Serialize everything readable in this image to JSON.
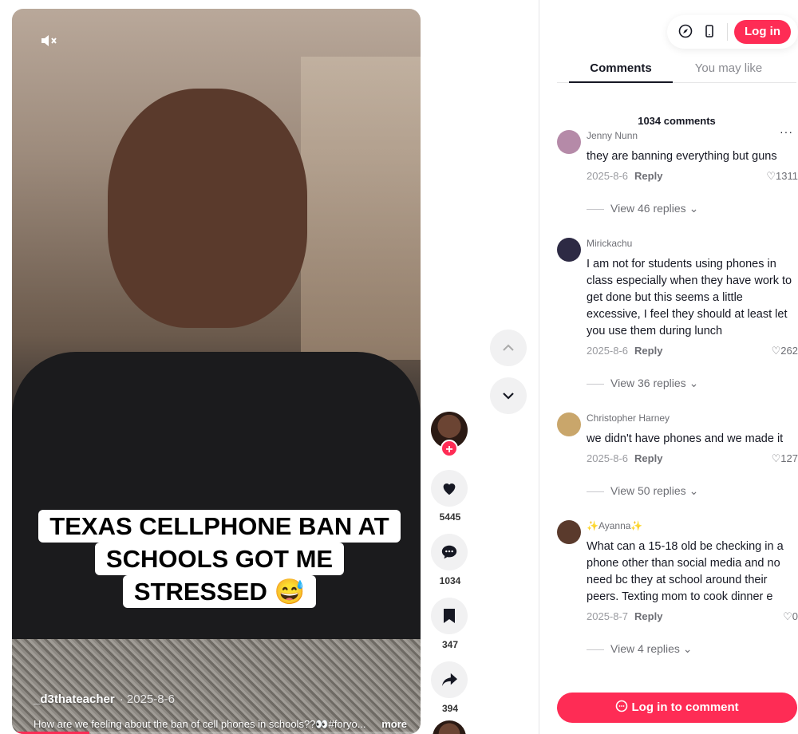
{
  "video": {
    "caption_lines": [
      "TEXAS CELLPHONE BAN AT",
      "SCHOOLS GOT ME",
      "STRESSED 😅"
    ],
    "author": "_d3thateacher",
    "date": "· 2025-8-6",
    "description": "How are we feeling about the ban of cell phones in schools??👀#foryo...",
    "more_label": "more",
    "progress": 0.19
  },
  "actions": {
    "likes": "5445",
    "comments": "1034",
    "bookmarks": "347",
    "shares": "394"
  },
  "topbar": {
    "login_label": "Log in"
  },
  "tabs": [
    {
      "label": "Comments",
      "active": true
    },
    {
      "label": "You may like",
      "active": false
    }
  ],
  "comment_count_label": "1034 comments",
  "comments": [
    {
      "user": "Jenny Nunn",
      "text": "they are banning everything but guns",
      "date": "2025-8-6",
      "reply_label": "Reply",
      "likes": "1311",
      "view_replies": "View 46 replies",
      "avatar_color": "#b58aa8"
    },
    {
      "user": "Mirickachu",
      "text": "I am not for students using phones in class especially when they have work to get done but this seems a little excessive, I feel they should at least let you use them during lunch",
      "date": "2025-8-6",
      "reply_label": "Reply",
      "likes": "262",
      "view_replies": "View 36 replies",
      "avatar_color": "#2d2a44"
    },
    {
      "user": "Christopher Harney",
      "text": "we didn't have phones and we made it",
      "date": "2025-8-6",
      "reply_label": "Reply",
      "likes": "127",
      "view_replies": "View 50 replies",
      "avatar_color": "#c9a66b"
    },
    {
      "user": "✨Ayanna✨",
      "text": "What can a 15-18 old be checking in a phone other than social media and no need bc they at school around their peers. Texting mom to cook dinner e",
      "date": "2025-8-7",
      "reply_label": "Reply",
      "likes": "0",
      "view_replies": "View 4 replies",
      "avatar_color": "#5a3a2c"
    }
  ],
  "login_to_comment_label": "Log in to comment",
  "colors": {
    "accent": "#fe2c55"
  }
}
